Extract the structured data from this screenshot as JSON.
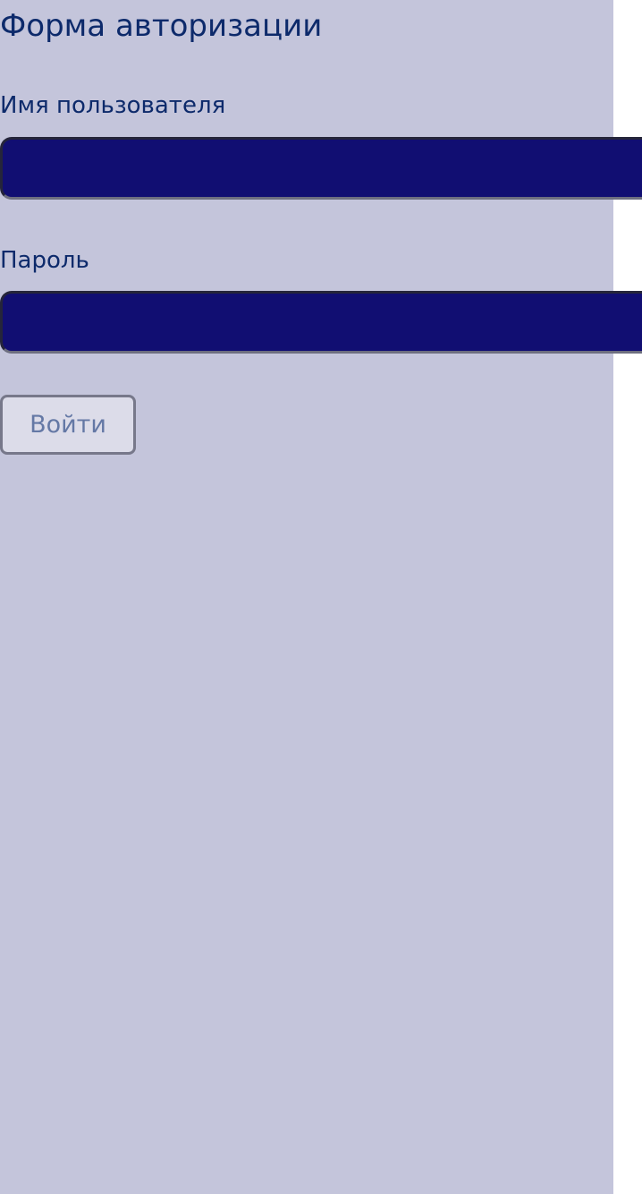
{
  "form": {
    "title": "Форма авторизации",
    "username": {
      "label": "Имя пользователя",
      "value": "",
      "placeholder": ""
    },
    "password": {
      "label": "Пароль",
      "value": "",
      "placeholder": ""
    },
    "submit_label": "Войти"
  },
  "colors": {
    "panel_background": "#c4c5db",
    "text": "#0d2a6b",
    "field_fill": "#110e72",
    "button_background": "#dcdce9",
    "button_text": "#6478a5"
  }
}
